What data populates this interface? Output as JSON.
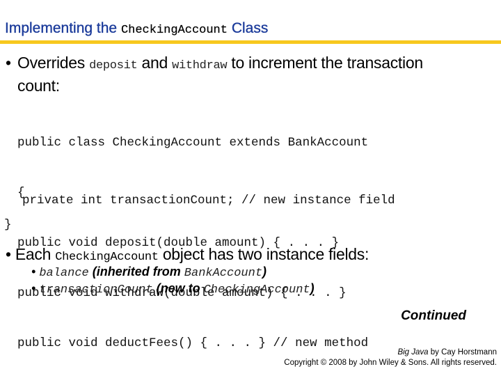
{
  "slide": {
    "title": {
      "prefix": "Implementing the",
      "code": "CheckingAccount",
      "suffix": "Class"
    },
    "bullet1": {
      "marker": "•",
      "t1": "Overrides",
      "c1": "deposit",
      "t2": "and",
      "c2": "withdraw",
      "t3": "to increment the transaction",
      "t4": "count:"
    },
    "code_lines": [
      "public class CheckingAccount extends BankAccount",
      "{",
      "public void deposit(double amount) { . . . }",
      "public void withdraw(double amount) { . . . }",
      "public void deductFees() { . . . } // new method"
    ],
    "code_private": "private int transactionCount; // new instance field",
    "code_close": "}",
    "bullet2": {
      "marker": "•",
      "t1": "Each",
      "c1": "CheckingAccount",
      "t2": "object has two instance fields:"
    },
    "sub_bullets": [
      {
        "marker": "•",
        "code": "balance",
        "text": "(inherited from",
        "code2": "BankAccount",
        "close": ")"
      },
      {
        "marker": "•",
        "code": "transactionCount",
        "text_open": "(",
        "text_bold": "new to",
        "code2": "CheckingAccount",
        "close": ")"
      }
    ],
    "continued": "Continued",
    "footer": {
      "book": "Big Java",
      "author": "by Cay Horstmann",
      "copyright": "Copyright © 2008 by John Wiley & Sons.  All rights reserved."
    }
  },
  "colors": {
    "title": "#1a3a9a",
    "rule": "#f7c81e"
  }
}
